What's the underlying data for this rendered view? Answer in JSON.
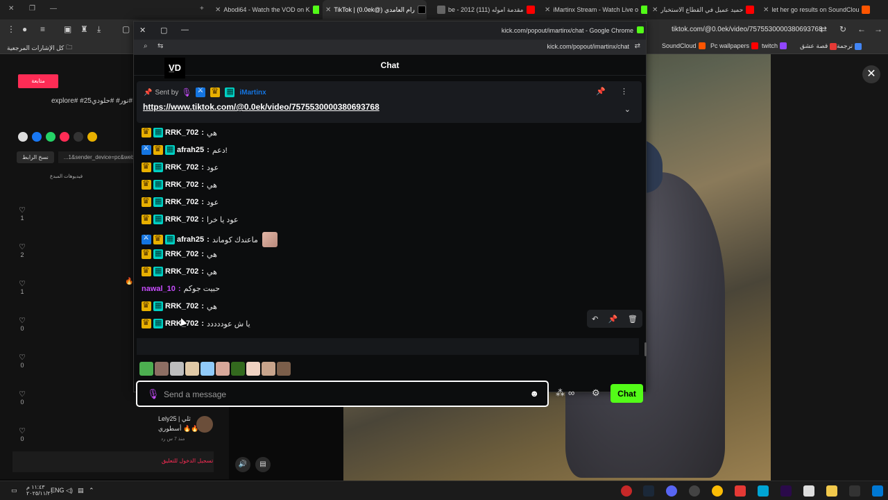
{
  "browser": {
    "tabs": [
      {
        "label": "Abodi64 - Watch the VOD on K",
        "color": "#53fc18"
      },
      {
        "label": "TikTok | (0.0ek@) رام العامدي",
        "color": "#ffffff"
      },
      {
        "label": "be - 2012 (111) مقدمة اموله",
        "color": "#ff0000"
      },
      {
        "label": "iMartinx Stream - Watch Live o",
        "color": "#53fc18"
      },
      {
        "label": "حميد عميل في القطاع الاستخبار",
        "color": "#ff0000"
      },
      {
        "label": "let her go results on SoundClou",
        "color": "#ff5500"
      }
    ],
    "url": "tiktok.com/@0.0ek/video/7575530000380693768",
    "bookmarks": [
      {
        "label": "كل الإشارات المرجعية",
        "color": "#cccccc"
      },
      {
        "label": "SoundCloud",
        "color": "#ff5500"
      },
      {
        "label": "Pc wallpapers",
        "color": "#ff0000"
      },
      {
        "label": "twitch",
        "color": "#9146ff"
      },
      {
        "label": "قصة عشق",
        "color": "#e53935"
      },
      {
        "label": "ترجمة",
        "color": "#4285f4"
      }
    ]
  },
  "tiktok": {
    "follow_label": "متابعة",
    "caption": "explore# #نور# #حلودي25# fo",
    "copy_link_label": "نسخ الرابط",
    "link_field": "...1&sender_device=pc&web",
    "creator_videos_label": "فيديوهات المبدع",
    "like_counts": [
      "1",
      "2",
      "1",
      "0",
      "0",
      "0",
      "0"
    ],
    "comment_user": "Lely25 | ثلي",
    "comment_text": "أسطوري 🔥🔥",
    "comment_meta": "منذ 7 س   رد",
    "login_prompt": "تسجيل الدخول للتعليق"
  },
  "popout": {
    "window_title": "kick.com/popout/imartinx/chat - Google Chrome",
    "url": "kick.com/popout/imartinx/chat",
    "chat_title": "Chat",
    "pinned": {
      "sent_by_label": "Sent by",
      "user": "iMartinx",
      "link": "https://www.tiktok.com/@0.0ek/video/7575530000380693768"
    },
    "messages": [
      {
        "user": "RRK_702",
        "text": "هي",
        "color": "#ffffff",
        "badges": [
          "crown",
          "sub"
        ]
      },
      {
        "user": "afrah25",
        "text": "دعم!",
        "color": "#ffffff",
        "badges": [
          "mod",
          "crown",
          "sub"
        ]
      },
      {
        "user": "RRK_702",
        "text": "عود",
        "color": "#ffffff",
        "badges": [
          "crown",
          "sub"
        ]
      },
      {
        "user": "RRK_702",
        "text": "هي",
        "color": "#ffffff",
        "badges": [
          "crown",
          "sub"
        ]
      },
      {
        "user": "RRK_702",
        "text": "عود",
        "color": "#ffffff",
        "badges": [
          "crown",
          "sub"
        ]
      },
      {
        "user": "RRK_702",
        "text": "عود يا خرا",
        "color": "#ffffff",
        "badges": [
          "crown",
          "sub"
        ]
      },
      {
        "user": "afrah25",
        "text": "ماعندك كوماند",
        "color": "#ffffff",
        "badges": [
          "mod",
          "crown",
          "sub"
        ],
        "emote": true
      },
      {
        "user": "RRK_702",
        "text": "هي",
        "color": "#ffffff",
        "badges": [
          "crown",
          "sub"
        ]
      },
      {
        "user": "RRK_702",
        "text": "هي",
        "color": "#ffffff",
        "badges": [
          "crown",
          "sub"
        ]
      },
      {
        "user": "nawal_10",
        "text": "حبيت جوكم",
        "color": "#c84dff",
        "badges": []
      },
      {
        "user": "RRK_702",
        "text": "هي",
        "color": "#ffffff",
        "badges": [
          "crown",
          "sub"
        ]
      },
      {
        "user": "RRK_702",
        "text": "يا ش عوددددد",
        "color": "#ffffff",
        "badges": [
          "crown",
          "sub"
        ]
      }
    ],
    "input_placeholder": "Send a message",
    "chat_button": "Chat",
    "points_symbol": "∞"
  },
  "taskbar": {
    "language": "ENG",
    "time": "١١:٤٣ م",
    "date": "٢٠٢٥/١١/٢٠"
  },
  "colors": {
    "kick_green": "#53fc18",
    "tiktok_pink": "#fe2c55",
    "mod_blue": "#1475e1"
  }
}
